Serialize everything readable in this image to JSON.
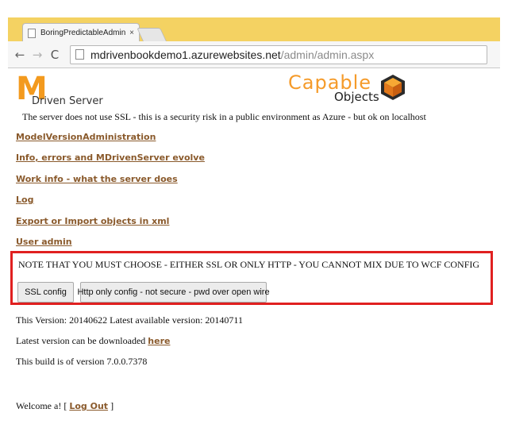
{
  "browser": {
    "tab_title": "BoringPredictableAdmin",
    "tab_close": "×",
    "url_host": "mdrivenbookdemo1.azurewebsites.net",
    "url_path": "/admin/admin.aspx",
    "back_glyph": "←",
    "forward_glyph": "→",
    "reload_glyph": "C"
  },
  "header": {
    "logo_letter": "M",
    "logo_subtitle": "Driven Server",
    "brand_word": "Capable",
    "brand_sub": "Objects"
  },
  "page": {
    "ssl_warning": "The server does not use SSL - this is a security risk in a public environment as Azure - but ok on localhost",
    "links": [
      "ModelVersionAdministration",
      "Info, errors and MDrivenServer evolve",
      "Work info - what the server does",
      "Log",
      "Export or Import objects in xml",
      "User admin"
    ],
    "note": "NOTE THAT YOU MUST CHOOSE - EITHER SSL OR ONLY HTTP - YOU CANNOT MIX DUE TO WCF CONFIG",
    "buttons": {
      "ssl_config": "SSL config",
      "http_only": "Http only config - not secure - pwd over open wire"
    },
    "version_line": "This Version: 20140622 Latest available version:  20140711",
    "download_prefix": "Latest version can be downloaded ",
    "download_link": "here",
    "build_line": "This build is of version 7.0.0.7378",
    "welcome_prefix": "Welcome   a! [ ",
    "logout_link": "Log Out",
    "welcome_suffix": " ]"
  },
  "colors": {
    "chrome_frame": "#f4d262",
    "link": "#8a5a2c",
    "highlight_border": "#e02020",
    "logo_orange": "#f39a1e"
  }
}
